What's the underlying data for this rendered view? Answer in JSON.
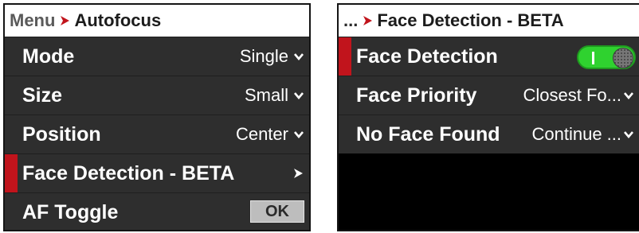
{
  "left_panel": {
    "breadcrumb_parent": "Menu",
    "breadcrumb_current": "Autofocus",
    "items": [
      {
        "label": "Mode",
        "value": "Single"
      },
      {
        "label": "Size",
        "value": "Small"
      },
      {
        "label": "Position",
        "value": "Center"
      },
      {
        "label": "Face Detection - BETA"
      },
      {
        "label": "AF Toggle",
        "button": "OK"
      }
    ]
  },
  "right_panel": {
    "breadcrumb_parent": "...",
    "breadcrumb_current": "Face Detection - BETA",
    "items": [
      {
        "label": "Face Detection",
        "toggle_state": "on"
      },
      {
        "label": "Face Priority",
        "value": "Closest Fo..."
      },
      {
        "label": "No Face Found",
        "value": "Continue ..."
      }
    ]
  },
  "colors": {
    "accent_red": "#c1141c",
    "toggle_green": "#2fd22f",
    "row_background": "#2e2e2e",
    "header_background": "#ffffff"
  },
  "icons": {
    "breadcrumb_separator": "triangle-right-icon",
    "dropdown": "chevron-down-icon",
    "submenu": "chevron-right-icon"
  }
}
